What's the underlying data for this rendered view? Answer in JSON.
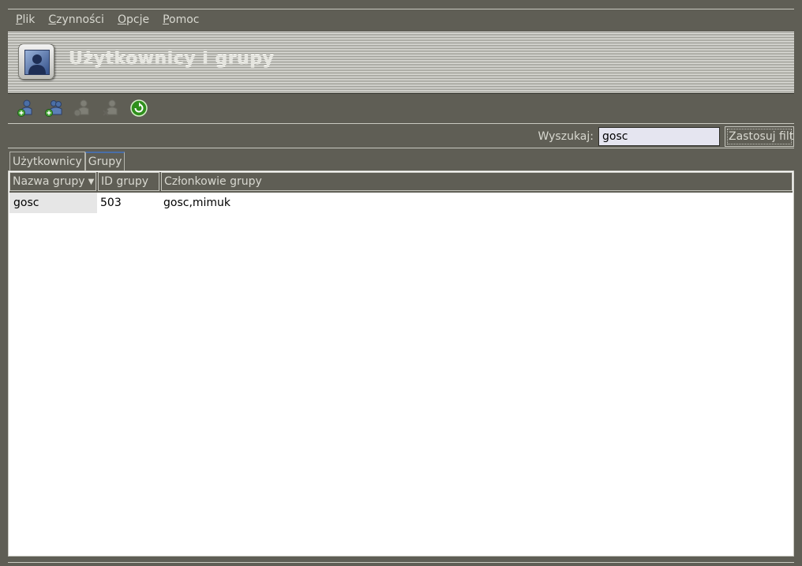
{
  "menu": [
    {
      "mnemonic": "P",
      "rest": "lik"
    },
    {
      "mnemonic": "C",
      "rest": "zynności"
    },
    {
      "mnemonic": "O",
      "rest": "pcje"
    },
    {
      "mnemonic": "P",
      "rest": "omoc"
    }
  ],
  "banner": {
    "title": "Użytkownicy i grupy",
    "icon": "users-groups-icon"
  },
  "toolbar": {
    "buttons": [
      {
        "icon": "add-user-icon",
        "enabled": true
      },
      {
        "icon": "add-group-icon",
        "enabled": true
      },
      {
        "icon": "edit-properties-icon",
        "enabled": false
      },
      {
        "icon": "delete-icon",
        "enabled": false
      },
      {
        "icon": "refresh-icon",
        "enabled": true
      }
    ]
  },
  "search": {
    "label": "Wyszukaj:",
    "value": "gosc",
    "apply_label": "Zastosuj filtr"
  },
  "tabs": [
    {
      "label": "Użytkownicy",
      "active": false
    },
    {
      "label": "Grupy",
      "active": true
    }
  ],
  "table": {
    "columns": [
      "Nazwa grupy",
      "ID grupy",
      "Członkowie grupy"
    ],
    "rows": [
      {
        "name": "gosc",
        "id": "503",
        "members": "gosc,mimuk"
      }
    ]
  },
  "colors": {
    "window_bg": "#5f5e55",
    "accent": "#4a6fa8",
    "selected_cell": "#e6e6e6"
  }
}
